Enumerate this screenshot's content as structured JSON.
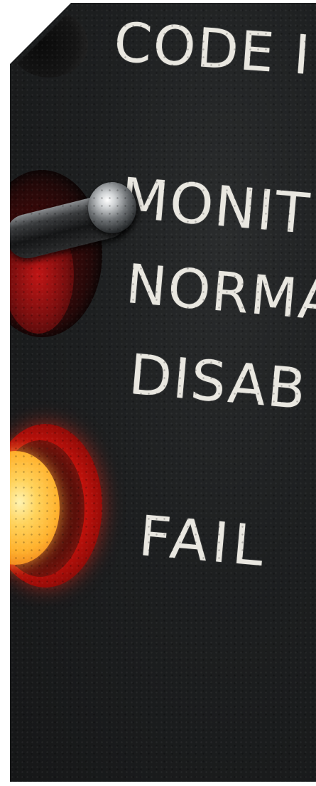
{
  "panel_labels": {
    "code": "CODE I",
    "monitor": "MONIT",
    "normal": "NORMA",
    "disable": "DISAB",
    "fail": "FAIL"
  },
  "colors": {
    "panel": "#1d1f20",
    "label_text": "#e9e7e0",
    "led_glow": "#ffb22e",
    "led_ring": "#e0150d"
  },
  "icons": {
    "toggle": "toggle-switch-icon",
    "indicator": "fail-indicator-led-icon"
  }
}
